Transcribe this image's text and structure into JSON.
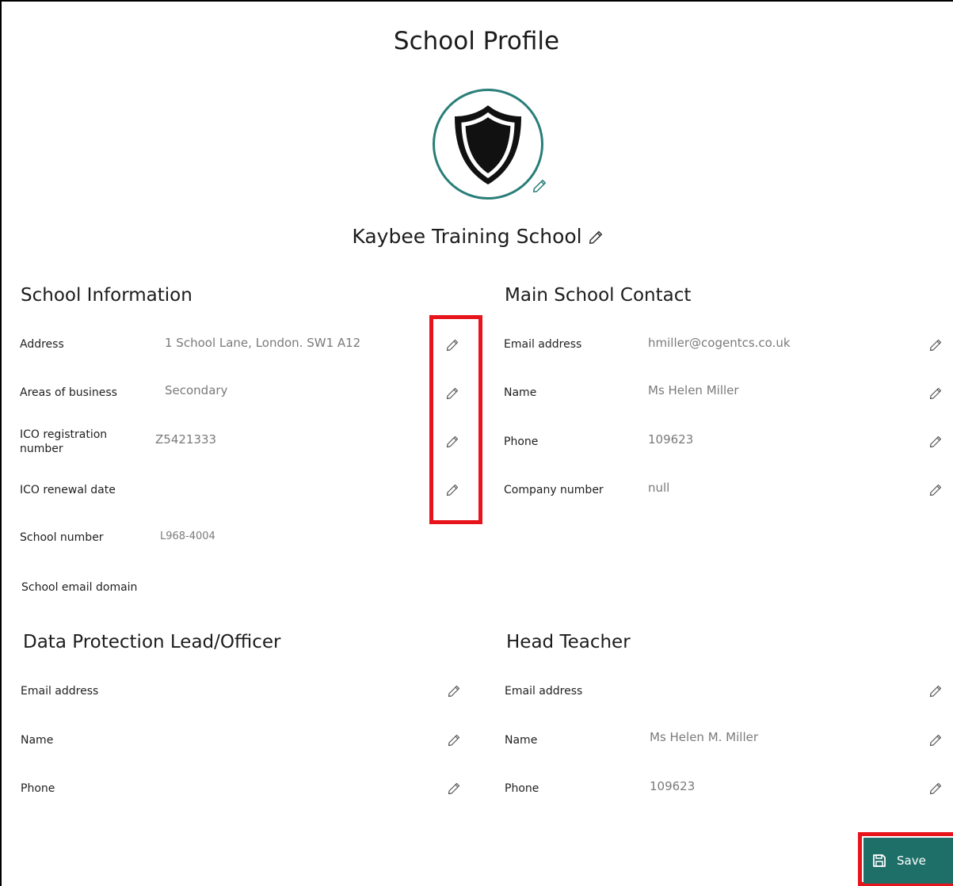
{
  "page": {
    "title": "School Profile"
  },
  "school": {
    "name": "Kaybee Training School"
  },
  "school_info": {
    "heading": "School Information",
    "rows": [
      {
        "label": "Address",
        "value": "1 School Lane, London. SW1 A12"
      },
      {
        "label": "Areas of business",
        "value": "Secondary"
      },
      {
        "label": "ICO registration number",
        "value": "Z5421333"
      },
      {
        "label": "ICO renewal date",
        "value": ""
      },
      {
        "label": "School number",
        "value": "L968-4004"
      },
      {
        "label": "School email domain",
        "value": ""
      }
    ]
  },
  "main_contact": {
    "heading": "Main School Contact",
    "rows": [
      {
        "label": "Email address",
        "value": "hmiller@cogentcs.co.uk"
      },
      {
        "label": "Name",
        "value": "Ms Helen Miller"
      },
      {
        "label": "Phone",
        "value": "109623"
      },
      {
        "label": "Company number",
        "value": "null"
      }
    ]
  },
  "dpo": {
    "heading": "Data Protection Lead/Officer",
    "rows": [
      {
        "label": "Email address",
        "value": ""
      },
      {
        "label": "Name",
        "value": ""
      },
      {
        "label": "Phone",
        "value": ""
      }
    ]
  },
  "head_teacher": {
    "heading": "Head Teacher",
    "rows": [
      {
        "label": "Email address",
        "value": ""
      },
      {
        "label": "Name",
        "value": "Ms Helen M. Miller"
      },
      {
        "label": "Phone",
        "value": "109623"
      }
    ]
  },
  "actions": {
    "save_label": "Save"
  },
  "colors": {
    "accent": "#1f6f69",
    "logo_ring": "#2a7e78",
    "highlight": "#e8141b"
  },
  "icons": {
    "edit": "pencil-icon",
    "save": "floppy-disk-icon",
    "logo": "shield-icon"
  }
}
